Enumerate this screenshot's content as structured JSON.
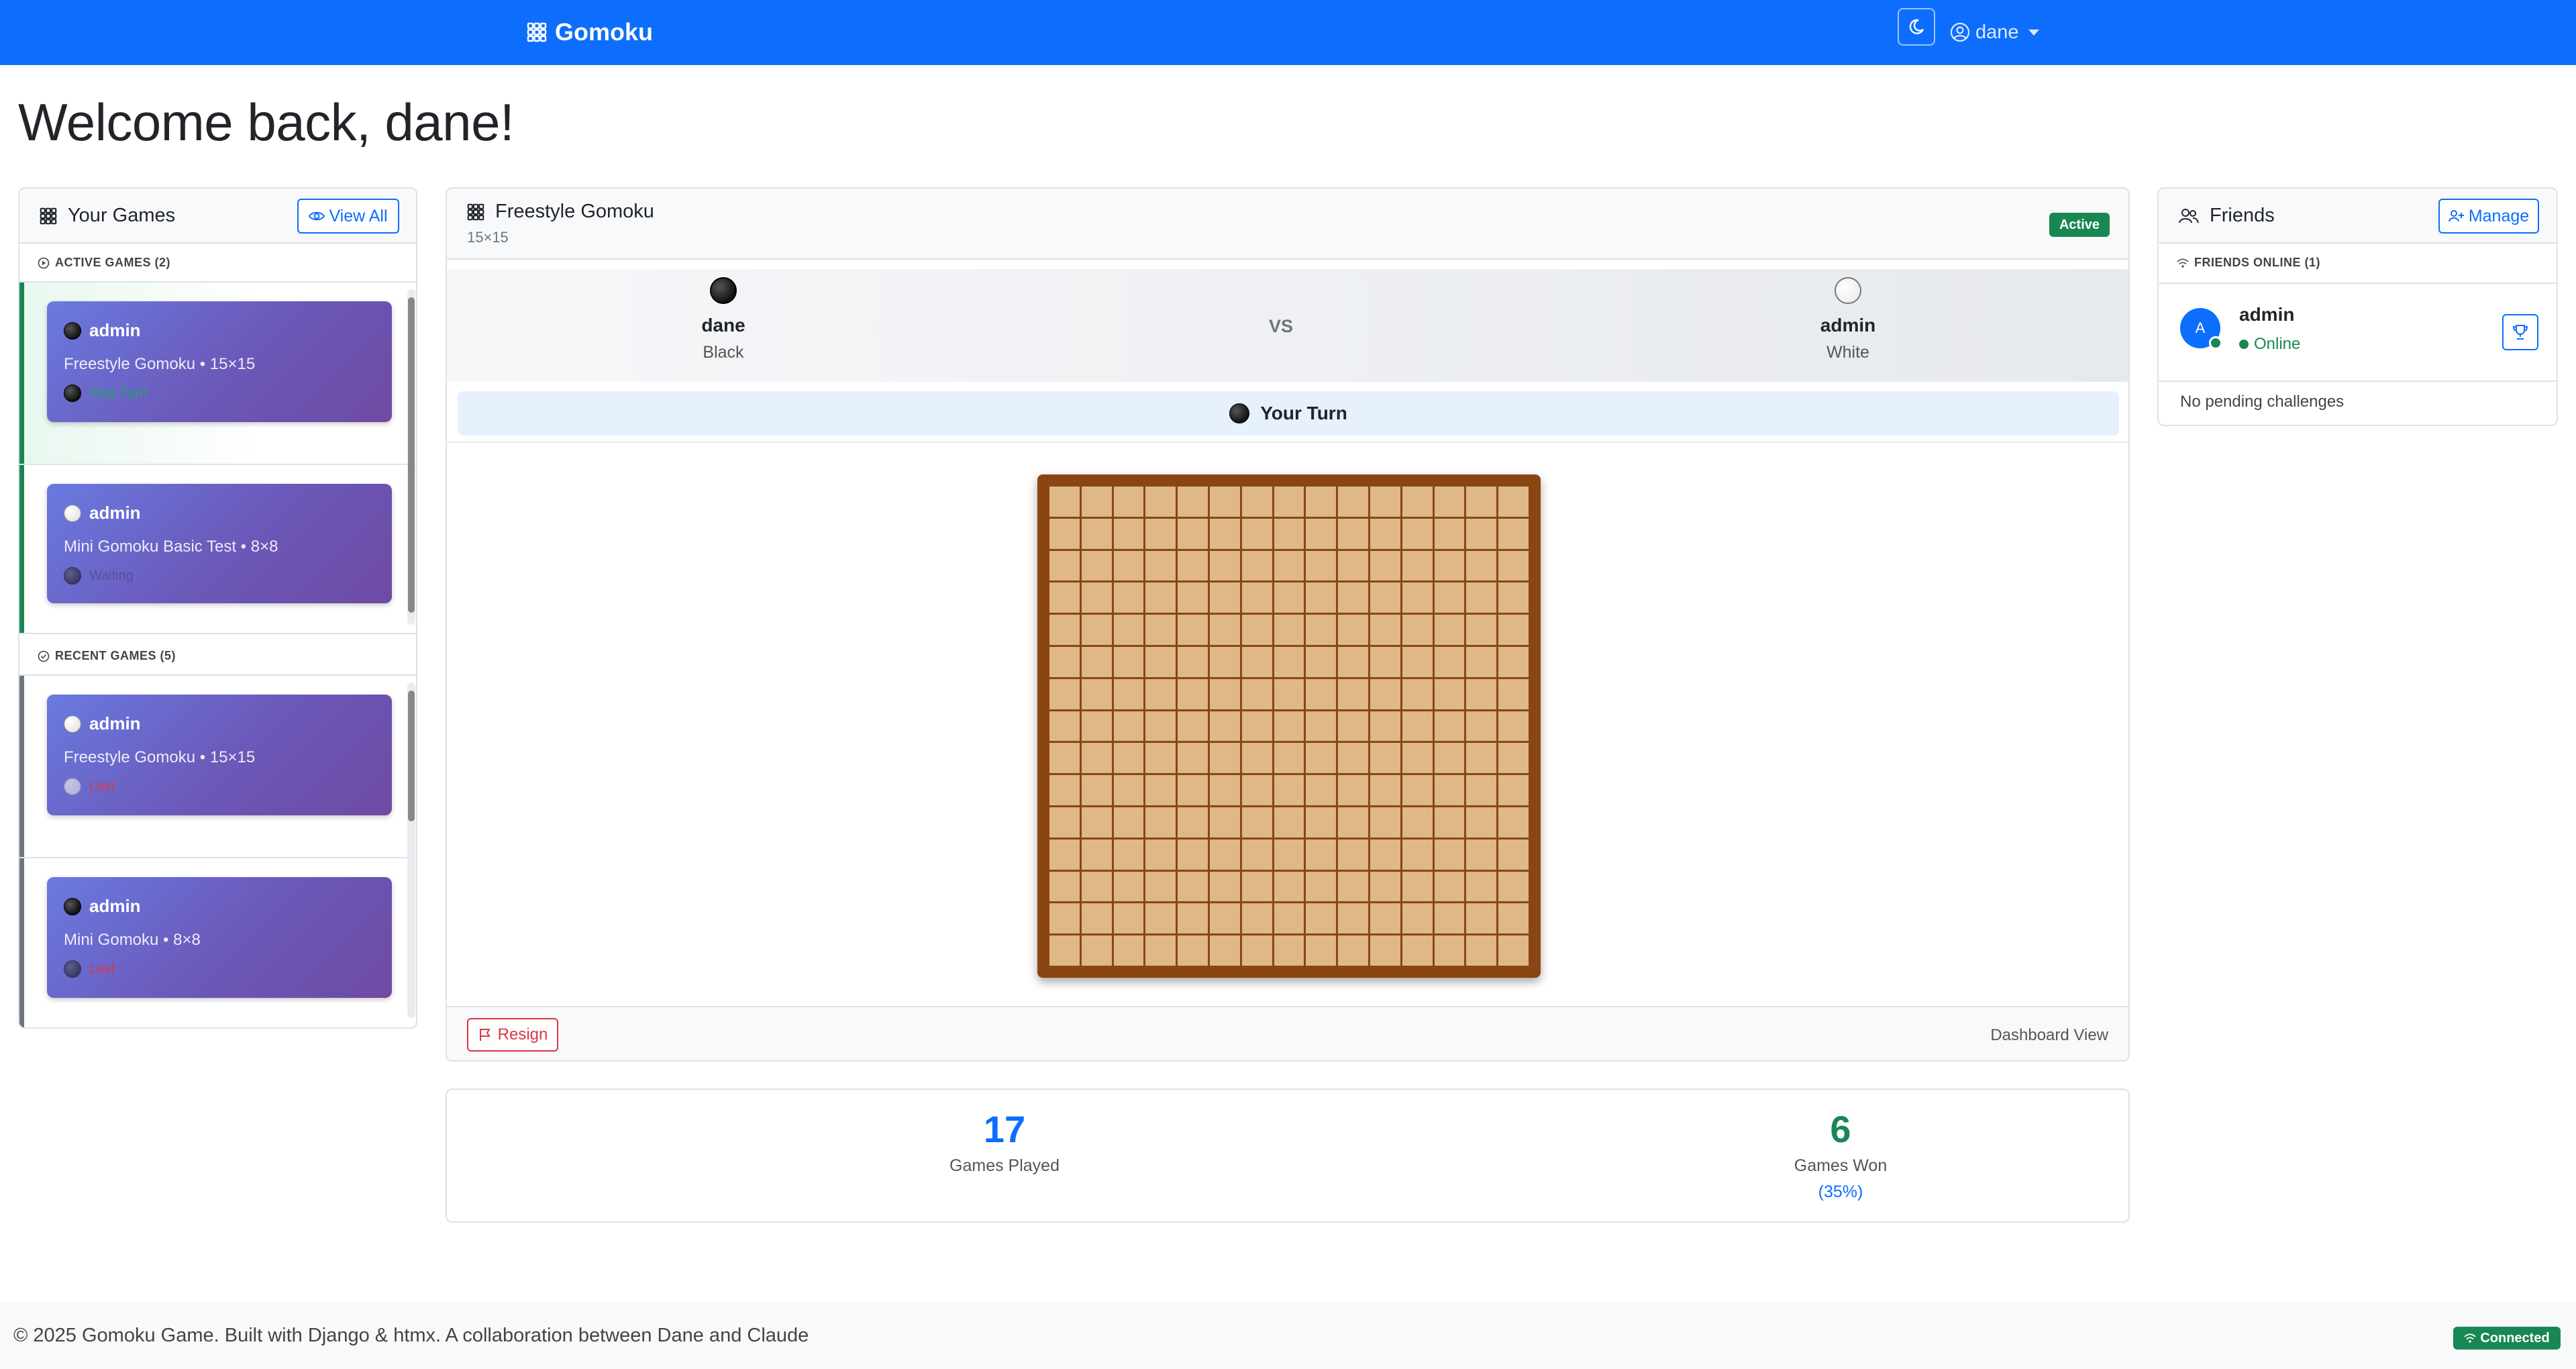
{
  "nav": {
    "brand": "Gomoku",
    "username": "dane",
    "brand_icon": "grid-icon",
    "theme_icon": "moon-icon",
    "user_icon": "person-circle-icon"
  },
  "welcome": "Welcome back, dane!",
  "your_games": {
    "title": "Your Games",
    "view_all": "View All",
    "active_label": "ACTIVE GAMES (2)",
    "recent_label": "RECENT GAMES (5)",
    "active": [
      {
        "opponent": "admin",
        "meta": "Freestyle Gomoku • 15×15",
        "status": "Your Turn",
        "stone": "black"
      },
      {
        "opponent": "admin",
        "meta": "Mini Gomoku Basic Test • 8×8",
        "status": "Waiting",
        "stone": "white"
      }
    ],
    "recent": [
      {
        "opponent": "admin",
        "meta": "Freestyle Gomoku • 15×15",
        "status": "Lost",
        "stone": "white"
      },
      {
        "opponent": "admin",
        "meta": "Mini Gomoku • 8×8",
        "status": "Lost",
        "stone": "black"
      }
    ]
  },
  "game": {
    "title": "Freestyle Gomoku",
    "size": "15×15",
    "status_badge": "Active",
    "player1": {
      "name": "dane",
      "color": "Black"
    },
    "player2": {
      "name": "admin",
      "color": "White"
    },
    "vs": "VS",
    "turn": "Your Turn",
    "resign": "Resign",
    "view_label": "Dashboard View"
  },
  "stats": {
    "played_value": "17",
    "played_label": "Games Played",
    "won_value": "6",
    "won_label": "Games Won",
    "won_pct": "(35%)"
  },
  "friends": {
    "title": "Friends",
    "manage": "Manage",
    "online_label": "FRIENDS ONLINE (1)",
    "friend_name": "admin",
    "friend_initial": "A",
    "friend_status": "Online",
    "pending": "No pending challenges"
  },
  "footer": {
    "copyright": "© 2025 Gomoku Game. Built with Django & htmx. A collaboration between Dane and Claude",
    "connection": "Connected"
  },
  "colors": {
    "primary": "#0d6efd",
    "success": "#198754",
    "danger": "#dc3545",
    "board_frame": "#8b4513",
    "board_cell": "#deb887"
  }
}
